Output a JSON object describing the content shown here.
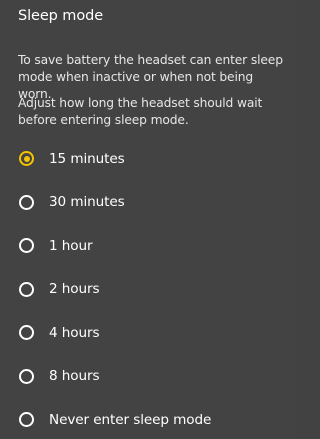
{
  "title": "Sleep mode",
  "description_1": "To save battery the headset can enter sleep mode when inactive or when not being worn.",
  "description_2": "Adjust how long the headset should wait before entering sleep mode.",
  "options": [
    {
      "label": "15 minutes",
      "selected": true
    },
    {
      "label": "30 minutes",
      "selected": false
    },
    {
      "label": "1 hour",
      "selected": false
    },
    {
      "label": "2 hours",
      "selected": false
    },
    {
      "label": "4 hours",
      "selected": false
    },
    {
      "label": "8 hours",
      "selected": false
    },
    {
      "label": "Never enter sleep mode",
      "selected": false
    }
  ],
  "colors": {
    "background": "#434343",
    "accent": "#f5c400",
    "text": "#ffffff"
  }
}
